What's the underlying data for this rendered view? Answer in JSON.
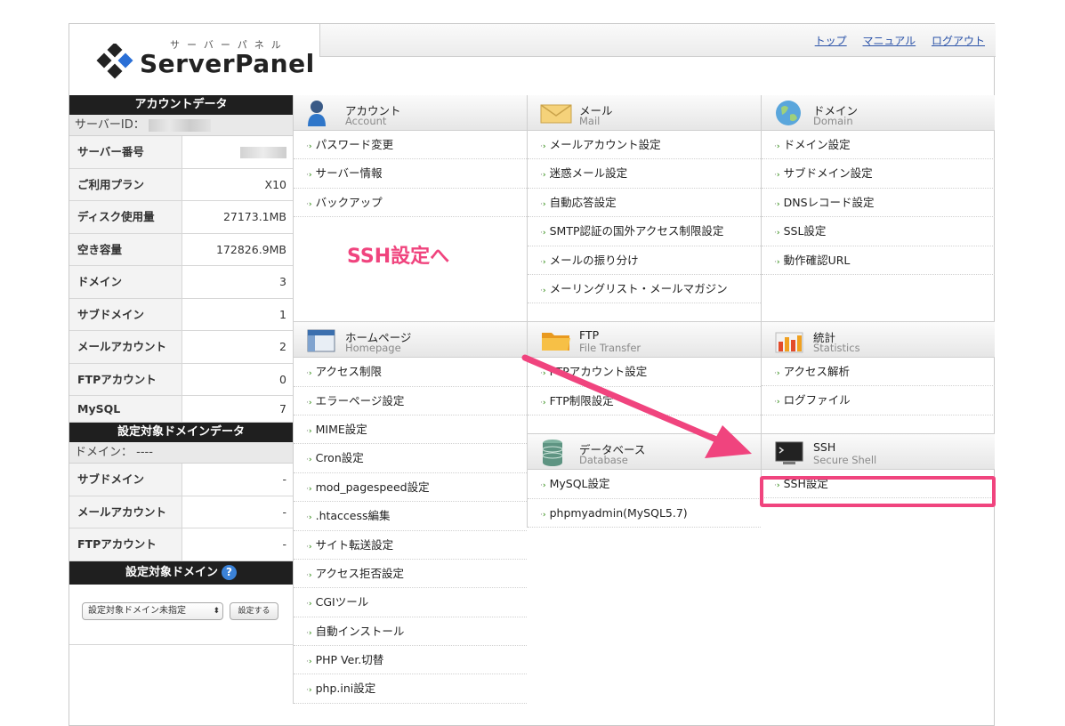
{
  "header": {
    "logo_kana": "サーバーパネル",
    "logo_name": "ServerPanel",
    "links": [
      "トップ",
      "マニュアル",
      "ログアウト"
    ]
  },
  "account": {
    "title": "アカウントデータ",
    "server_id_label": "サーバーID：",
    "rows": [
      {
        "key": "サーバー番号",
        "value": ""
      },
      {
        "key": "ご利用プラン",
        "value": "X10"
      },
      {
        "key": "ディスク使用量",
        "value": "27173.1MB"
      },
      {
        "key": "空き容量",
        "value": "172826.9MB"
      },
      {
        "key": "ドメイン",
        "value": "3"
      },
      {
        "key": "サブドメイン",
        "value": "1"
      },
      {
        "key": "メールアカウント",
        "value": "2"
      },
      {
        "key": "FTPアカウント",
        "value": "0"
      },
      {
        "key": "MySQL",
        "value": "7"
      }
    ]
  },
  "target_domain_data": {
    "title": "設定対象ドメインデータ",
    "domain_label": "ドメイン： ----",
    "rows": [
      {
        "key": "サブドメイン",
        "value": "-"
      },
      {
        "key": "メールアカウント",
        "value": "-"
      },
      {
        "key": "FTPアカウント",
        "value": "-"
      }
    ]
  },
  "target_domain": {
    "title": "設定対象ドメイン",
    "help": "?",
    "select_value": "設定対象ドメイン未指定",
    "button": "設定する"
  },
  "sections": {
    "account": {
      "title": "アカウント",
      "sub": "Account",
      "items": [
        "パスワード変更",
        "サーバー情報",
        "バックアップ"
      ]
    },
    "homepage": {
      "title": "ホームページ",
      "sub": "Homepage",
      "items": [
        "アクセス制限",
        "エラーページ設定",
        "MIME設定",
        "Cron設定",
        "mod_pagespeed設定",
        ".htaccess編集",
        "サイト転送設定",
        "アクセス拒否設定",
        "CGIツール",
        "自動インストール",
        "PHP Ver.切替",
        "php.ini設定"
      ]
    },
    "mail": {
      "title": "メール",
      "sub": "Mail",
      "items": [
        "メールアカウント設定",
        "迷惑メール設定",
        "自動応答設定",
        "SMTP認証の国外アクセス制限設定",
        "メールの振り分け",
        "メーリングリスト・メールマガジン"
      ]
    },
    "ftp": {
      "title": "FTP",
      "sub": "File Transfer",
      "items": [
        "FTPアカウント設定",
        "FTP制限設定"
      ]
    },
    "database": {
      "title": "データベース",
      "sub": "Database",
      "items": [
        "MySQL設定",
        "phpmyadmin(MySQL5.7)"
      ]
    },
    "domain": {
      "title": "ドメイン",
      "sub": "Domain",
      "items": [
        "ドメイン設定",
        "サブドメイン設定",
        "DNSレコード設定",
        "SSL設定",
        "動作確認URL"
      ]
    },
    "stats": {
      "title": "統計",
      "sub": "Statistics",
      "items": [
        "アクセス解析",
        "ログファイル"
      ]
    },
    "ssh": {
      "title": "SSH",
      "sub": "Secure Shell",
      "items": [
        "SSH設定"
      ]
    }
  },
  "annotation": "SSH設定へ",
  "colors": {
    "highlight": "#f0447e",
    "link": "#2a52a8"
  }
}
